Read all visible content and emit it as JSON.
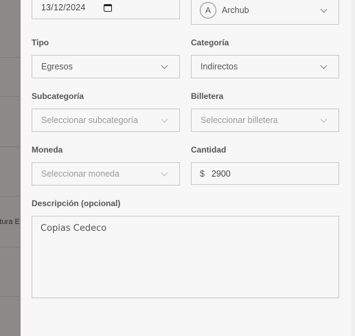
{
  "background": {
    "peek_text": "ctura E"
  },
  "form": {
    "date": {
      "value": "13/12/2024",
      "icon": "calendar-icon"
    },
    "member": {
      "avatar_initial": "A",
      "value": "Archub"
    },
    "tipo": {
      "label": "Tipo",
      "value": "Egresos"
    },
    "categoria": {
      "label": "Categoría",
      "value": "Indirectos"
    },
    "subcategoria": {
      "label": "Subcategoría",
      "placeholder": "Seleccionar subcategoría"
    },
    "billetera": {
      "label": "Billetera",
      "placeholder": "Seleccionar billetera"
    },
    "moneda": {
      "label": "Moneda",
      "placeholder": "Seleccionar moneda"
    },
    "cantidad": {
      "label": "Cantidad",
      "currency_symbol": "$",
      "value": "2900"
    },
    "descripcion": {
      "label": "Descripción (opcional)",
      "value": "Copias Cedeco"
    }
  },
  "colors": {
    "panel_bg": "#f7f7f7",
    "border": "#c9c9c9",
    "overlay": "#8a8888"
  }
}
